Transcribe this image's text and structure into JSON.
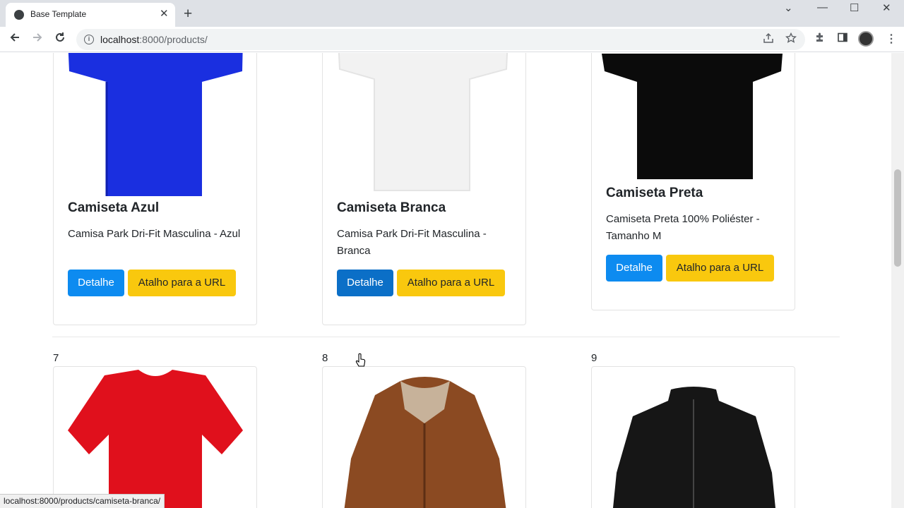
{
  "browser": {
    "tab_title": "Base Template",
    "tab_close": "✕",
    "new_tab": "+",
    "url_host": "localhost",
    "url_path": ":8000/products/",
    "status_url": "localhost:8000/products/camiseta-branca/",
    "window_controls": [
      "⌄",
      "—",
      "☐",
      "✕"
    ],
    "nav_icons": [
      "back-arrow",
      "forward-arrow",
      "reload"
    ]
  },
  "products_row1": [
    {
      "title": "Camiseta Azul",
      "description": "Camisa Park Dri-Fit Masculina - Azul",
      "detail_label": "Detalhe",
      "url_label": "Atalho para a URL",
      "color": "#1a2fe0"
    },
    {
      "title": "Camiseta Branca",
      "description": "Camisa Park Dri-Fit Masculina - Branca",
      "detail_label": "Detalhe",
      "url_label": "Atalho para a URL",
      "color": "#f2f2f2"
    },
    {
      "title": "Camiseta Preta",
      "description": "Camiseta Preta 100% Poliéster - Tamanho M",
      "detail_label": "Detalhe",
      "url_label": "Atalho para a URL",
      "color": "#0b0b0b"
    }
  ],
  "products_row2": [
    {
      "number": "7",
      "color": "#e0101c"
    },
    {
      "number": "8",
      "color": "#8b4a22"
    },
    {
      "number": "9",
      "color": "#161616"
    }
  ],
  "colors": {
    "primary": "#0d8bf0",
    "warning": "#f9c80e"
  }
}
